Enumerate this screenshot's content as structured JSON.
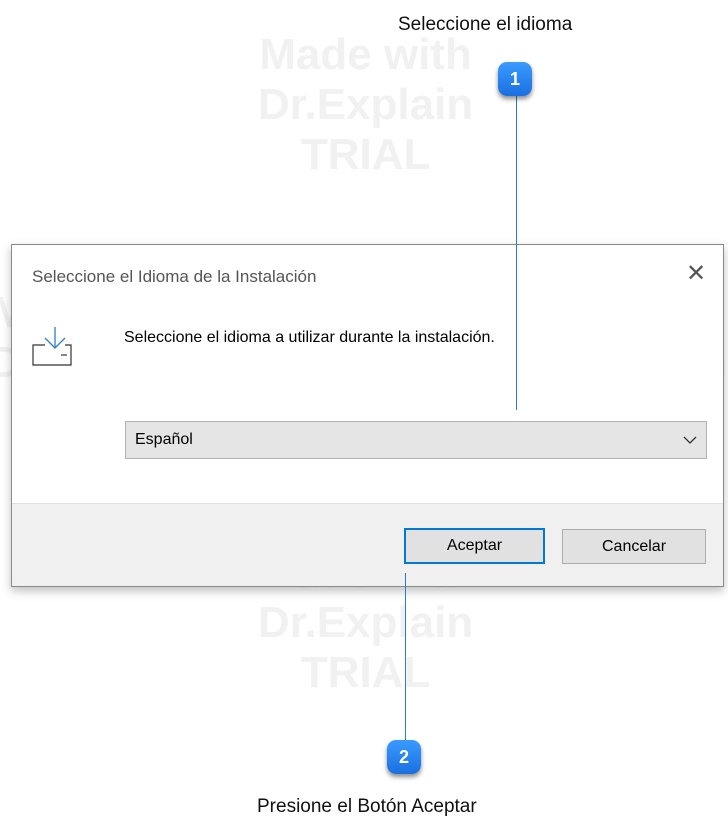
{
  "callouts": [
    {
      "number": "1",
      "text": "Seleccione el idioma"
    },
    {
      "number": "2",
      "text": "Presione el Botón Aceptar"
    }
  ],
  "watermark": {
    "text": "Made with\nDr.Explain\nTRIAL"
  },
  "dialog": {
    "title": "Seleccione el Idioma de la Instalación",
    "close_glyph": "✕",
    "icon": "install-download-icon",
    "message": "Seleccione el idioma a utilizar durante la instalación.",
    "language_select": {
      "selected": "Español"
    },
    "ok_label": "Aceptar",
    "cancel_label": "Cancelar"
  },
  "colors": {
    "accent": "#0078d7",
    "callout_badge": "#1a6fe0",
    "callout_line": "#2b7cd3"
  }
}
